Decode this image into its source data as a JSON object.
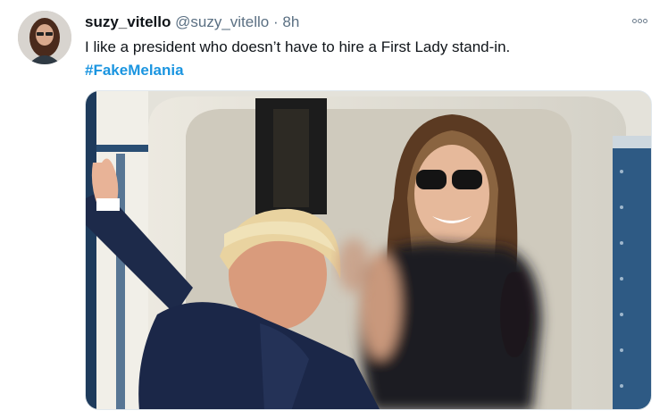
{
  "tweet": {
    "author": {
      "display_name": "suzy_vitello",
      "handle": "@suzy_vitello",
      "separator": "·",
      "time": "8h",
      "avatar": "profile-photo"
    },
    "text": "I like a president who doesn’t have to hire a First Lady stand-in.",
    "hashtag": "#FakeMelania",
    "more_icon": "more-options-icon",
    "media": {
      "type": "photo",
      "description_icon": "photo"
    }
  },
  "colors": {
    "text": "#0f1419",
    "secondary": "#5b7083",
    "link": "#1b95e0"
  }
}
